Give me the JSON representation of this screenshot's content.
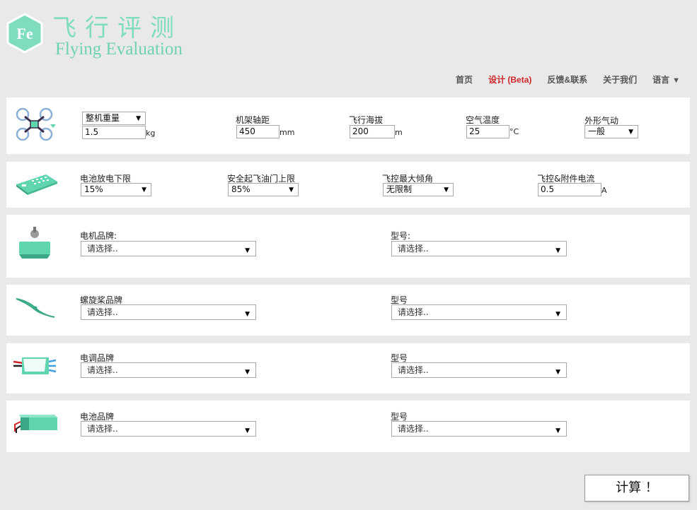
{
  "header": {
    "logo_text": "Fe",
    "title_cn": "飞行评测",
    "title_en": "Flying Evaluation"
  },
  "nav": {
    "items": [
      "首页",
      "设计 (Beta)",
      "反馈&联系",
      "关于我们",
      "语言"
    ],
    "active_index": 1,
    "language_caret": "▼"
  },
  "frame": {
    "weight_select": "整机重量",
    "weight_value": "1.5",
    "weight_unit": "kg",
    "arm_label": "机架轴距",
    "arm_value": "450",
    "arm_unit": "mm",
    "altitude_label": "飞行海拔",
    "altitude_value": "200",
    "altitude_unit": "m",
    "temp_label": "空气温度",
    "temp_value": "25",
    "temp_unit": "°C",
    "aero_label": "外形气动",
    "aero_value": "一般"
  },
  "battery_limits": {
    "discharge_label": "电池放电下限",
    "discharge_value": "15%",
    "throttle_label": "安全起飞油门上限",
    "throttle_value": "85%",
    "tilt_label": "飞控最大倾角",
    "tilt_value": "无限制",
    "current_label": "飞控&附件电流",
    "current_value": "0.5",
    "current_unit": "A"
  },
  "motor": {
    "brand_label": "电机品牌:",
    "brand_value": "请选择..",
    "model_label": "型号:",
    "model_value": "请选择.."
  },
  "propeller": {
    "brand_label": "螺旋桨品牌",
    "brand_value": "请选择..",
    "model_label": "型号",
    "model_value": "请选择.."
  },
  "esc": {
    "brand_label": "电调品牌",
    "brand_value": "请选择..",
    "model_label": "型号",
    "model_value": "请选择.."
  },
  "battery": {
    "brand_label": "电池品牌",
    "brand_value": "请选择..",
    "model_label": "型号",
    "model_value": "请选择.."
  },
  "calculate_label": "计算 ！",
  "colors": {
    "accent": "#6fd3b2",
    "active_nav": "#d0262a",
    "icon_fill": "#5fd6b0"
  }
}
